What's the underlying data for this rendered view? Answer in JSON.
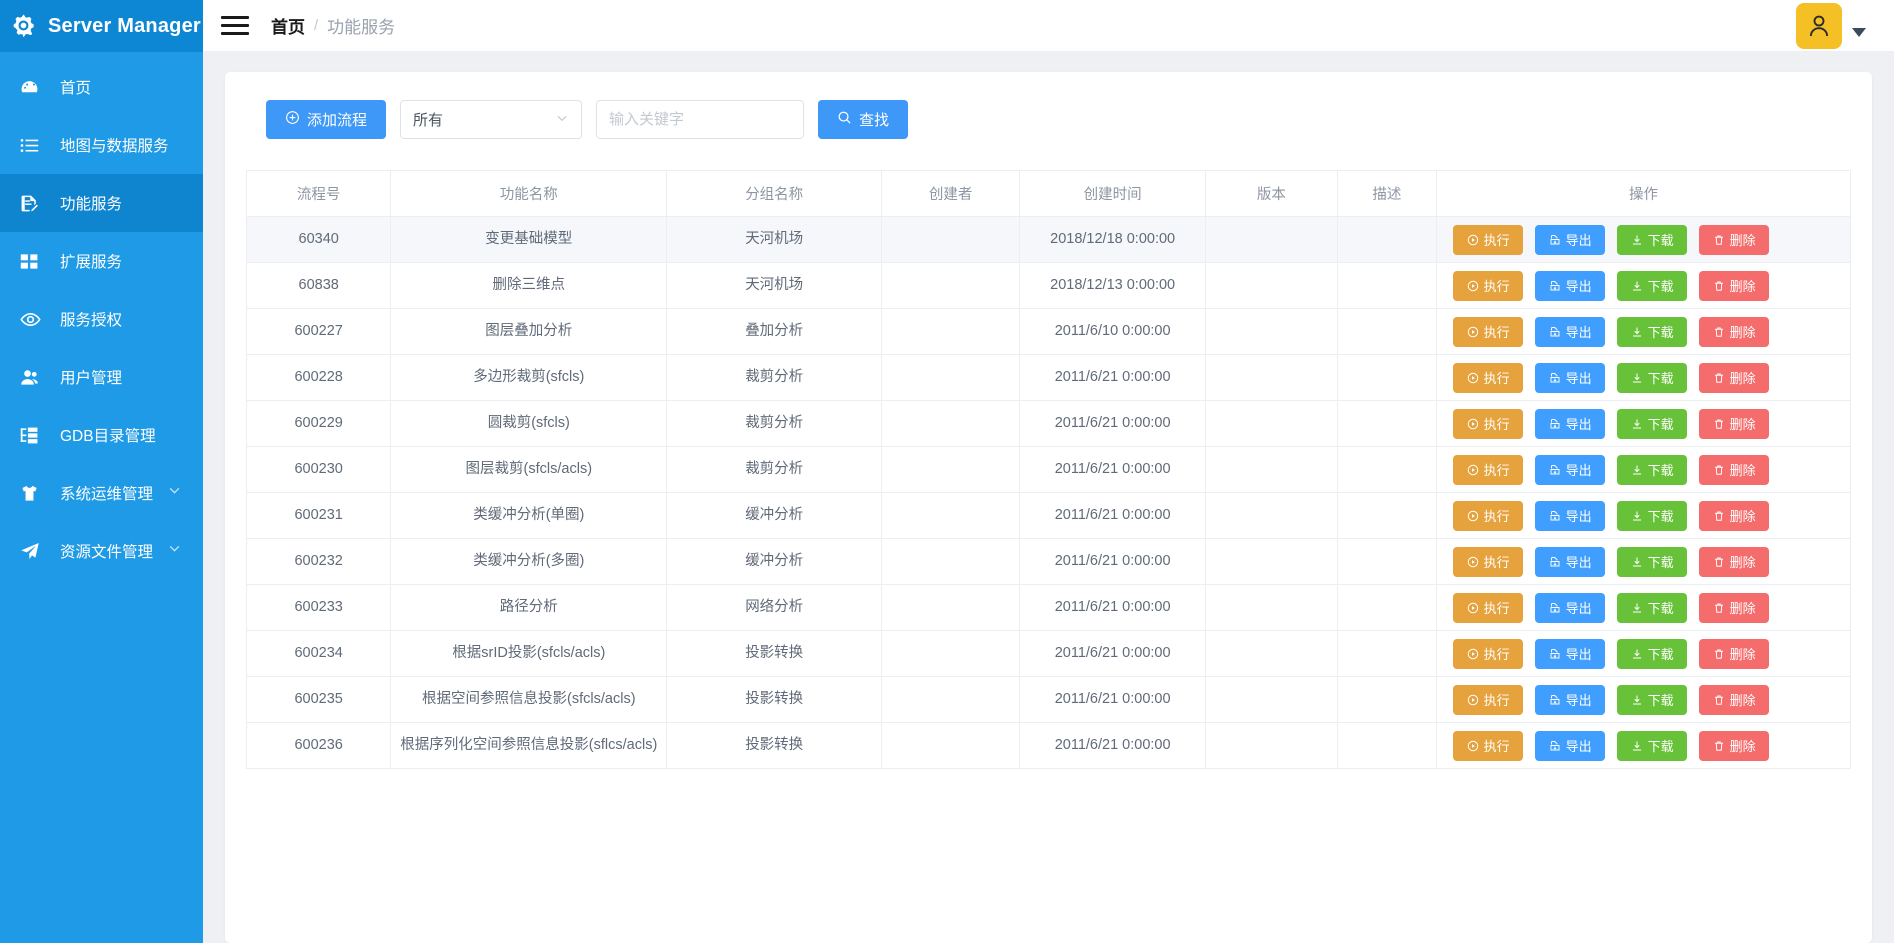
{
  "brand": {
    "title": "Server Manager",
    "icon": "gear-search-icon"
  },
  "sidebar": {
    "items": [
      {
        "label": "首页",
        "icon": "dashboard-icon",
        "active": false,
        "expandable": false
      },
      {
        "label": "地图与数据服务",
        "icon": "list-icon",
        "active": false,
        "expandable": false
      },
      {
        "label": "功能服务",
        "icon": "document-edit-icon",
        "active": true,
        "expandable": false
      },
      {
        "label": "扩展服务",
        "icon": "grid-icon",
        "active": false,
        "expandable": false
      },
      {
        "label": "服务授权",
        "icon": "eye-icon",
        "active": false,
        "expandable": false
      },
      {
        "label": "用户管理",
        "icon": "user-icon",
        "active": false,
        "expandable": false
      },
      {
        "label": "GDB目录管理",
        "icon": "tree-icon",
        "active": false,
        "expandable": false
      },
      {
        "label": "系统运维管理",
        "icon": "shirt-icon",
        "active": false,
        "expandable": true
      },
      {
        "label": "资源文件管理",
        "icon": "send-icon",
        "active": false,
        "expandable": true
      }
    ]
  },
  "topbar": {
    "menu_icon": "hamburger-icon",
    "breadcrumb": {
      "home": "首页",
      "separator": "/",
      "current": "功能服务"
    },
    "avatar_icon": "user-avatar-icon",
    "dropdown_icon": "caret-down-icon"
  },
  "toolbar": {
    "add_label": "添加流程",
    "add_icon": "plus-circle-icon",
    "filter_value": "所有",
    "filter_caret": "chevron-down-icon",
    "search_placeholder": "输入关键字",
    "search_value": "",
    "search_label": "查找",
    "search_icon": "search-icon"
  },
  "table": {
    "columns": [
      "流程号",
      "功能名称",
      "分组名称",
      "创建者",
      "创建时间",
      "版本",
      "描述",
      "操作"
    ],
    "actions": [
      {
        "label": "执行",
        "icon": "play-circle-icon",
        "color": "#e6a23c"
      },
      {
        "label": "导出",
        "icon": "export-icon",
        "color": "#409eff"
      },
      {
        "label": "下载",
        "icon": "download-icon",
        "color": "#67c23a"
      },
      {
        "label": "删除",
        "icon": "trash-icon",
        "color": "#f56c6c"
      }
    ],
    "rows": [
      {
        "id": "60340",
        "name": "变更基础模型",
        "group": "天河机场",
        "author": "",
        "time": "2018/12/18 0:00:00",
        "version": "",
        "desc": "",
        "highlight": true
      },
      {
        "id": "60838",
        "name": "删除三维点",
        "group": "天河机场",
        "author": "",
        "time": "2018/12/13 0:00:00",
        "version": "",
        "desc": "",
        "highlight": false
      },
      {
        "id": "600227",
        "name": "图层叠加分析",
        "group": "叠加分析",
        "author": "",
        "time": "2011/6/10 0:00:00",
        "version": "",
        "desc": "",
        "highlight": false
      },
      {
        "id": "600228",
        "name": "多边形裁剪(sfcls)",
        "group": "裁剪分析",
        "author": "",
        "time": "2011/6/21 0:00:00",
        "version": "",
        "desc": "",
        "highlight": false
      },
      {
        "id": "600229",
        "name": "圆裁剪(sfcls)",
        "group": "裁剪分析",
        "author": "",
        "time": "2011/6/21 0:00:00",
        "version": "",
        "desc": "",
        "highlight": false
      },
      {
        "id": "600230",
        "name": "图层裁剪(sfcls/acls)",
        "group": "裁剪分析",
        "author": "",
        "time": "2011/6/21 0:00:00",
        "version": "",
        "desc": "",
        "highlight": false
      },
      {
        "id": "600231",
        "name": "类缓冲分析(单圈)",
        "group": "缓冲分析",
        "author": "",
        "time": "2011/6/21 0:00:00",
        "version": "",
        "desc": "",
        "highlight": false
      },
      {
        "id": "600232",
        "name": "类缓冲分析(多圈)",
        "group": "缓冲分析",
        "author": "",
        "time": "2011/6/21 0:00:00",
        "version": "",
        "desc": "",
        "highlight": false
      },
      {
        "id": "600233",
        "name": "路径分析",
        "group": "网络分析",
        "author": "",
        "time": "2011/6/21 0:00:00",
        "version": "",
        "desc": "",
        "highlight": false
      },
      {
        "id": "600234",
        "name": "根据srID投影(sfcls/acls)",
        "group": "投影转换",
        "author": "",
        "time": "2011/6/21 0:00:00",
        "version": "",
        "desc": "",
        "highlight": false
      },
      {
        "id": "600235",
        "name": "根据空间参照信息投影(sfcls/acls)",
        "group": "投影转换",
        "author": "",
        "time": "2011/6/21 0:00:00",
        "version": "",
        "desc": "",
        "highlight": false
      },
      {
        "id": "600236",
        "name": "根据序列化空间参照信息投影(sflcs/acls)",
        "group": "投影转换",
        "author": "",
        "time": "2011/6/21 0:00:00",
        "version": "",
        "desc": "",
        "highlight": false
      }
    ]
  },
  "colors": {
    "sidebar": "#1e9ae6",
    "sidebar_active": "#0f85cf",
    "brand_bg": "#0d86d4",
    "primary": "#3d98f7",
    "avatar": "#f5c026"
  }
}
